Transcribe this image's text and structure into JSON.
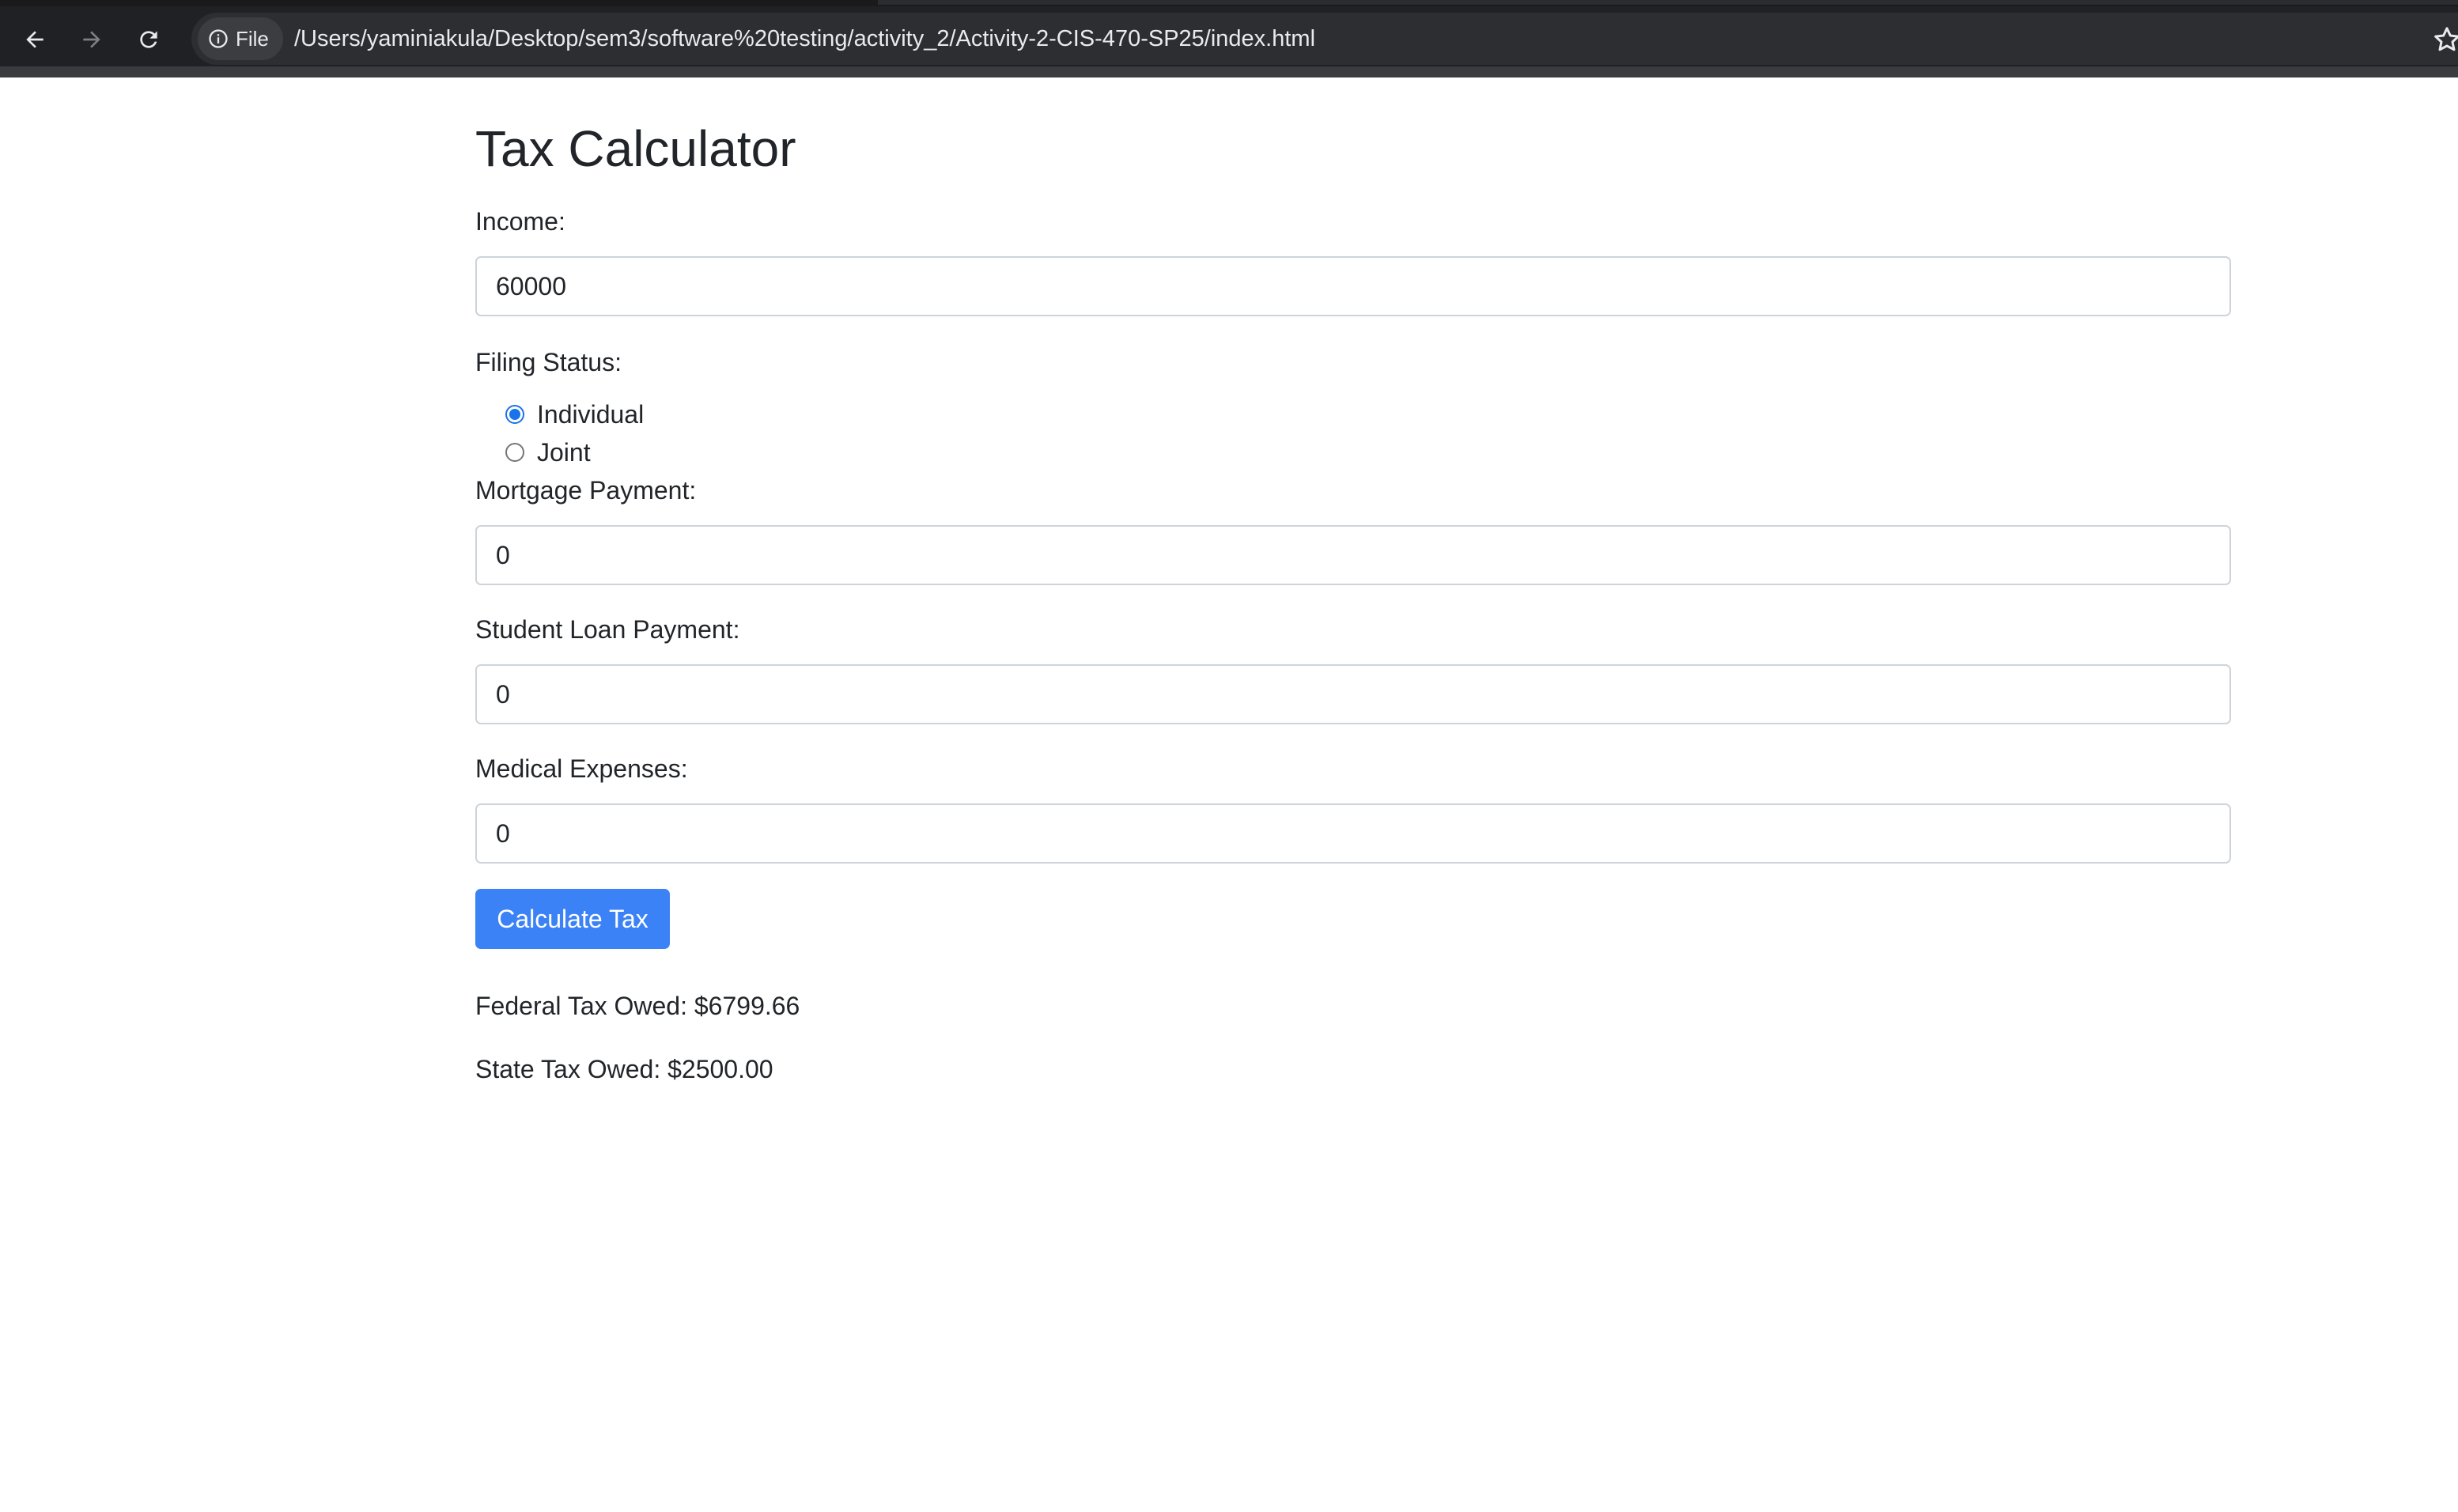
{
  "browser": {
    "chip_label": "File",
    "url": "/Users/yaminiakula/Desktop/sem3/software%20testing/activity_2/Activity-2-CIS-470-SP25/index.html",
    "icons": [
      "back-arrow-icon",
      "forward-arrow-icon",
      "reload-icon",
      "info-icon",
      "star-icon"
    ]
  },
  "page": {
    "title": "Tax Calculator",
    "income": {
      "label": "Income:",
      "value": "60000"
    },
    "filing_status": {
      "label": "Filing Status:",
      "options": [
        {
          "label": "Individual",
          "checked": true
        },
        {
          "label": "Joint",
          "checked": false
        }
      ]
    },
    "mortgage": {
      "label": "Mortgage Payment:",
      "value": "0"
    },
    "student_loan": {
      "label": "Student Loan Payment:",
      "value": "0"
    },
    "medical": {
      "label": "Medical Expenses:",
      "value": "0"
    },
    "calculate_button": "Calculate Tax",
    "results": {
      "federal": "Federal Tax Owed: $6799.66",
      "state": "State Tax Owed: $2500.00"
    }
  },
  "colors": {
    "chrome_bg": "#202124",
    "omnibox_bg": "#2d2e31",
    "button_primary": "#3b82f6",
    "radio_checked": "#1a73e8",
    "text": "#212529",
    "input_border": "#ced4da"
  }
}
